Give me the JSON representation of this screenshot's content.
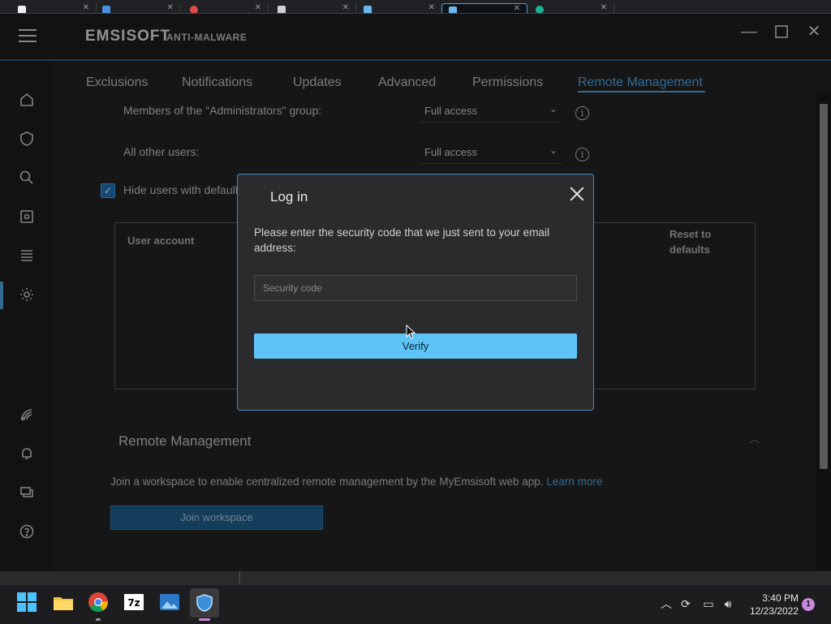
{
  "app": {
    "brand": "EMSISOFT",
    "product": "ANTI-MALWARE",
    "accent": "#4aa8e0"
  },
  "tabs": [
    {
      "label": "Exclusions"
    },
    {
      "label": "Notifications"
    },
    {
      "label": "Updates"
    },
    {
      "label": "Advanced"
    },
    {
      "label": "Permissions"
    },
    {
      "label": "Remote Management",
      "active": true
    }
  ],
  "permissions": {
    "admins_label": "Members of the \"Administrators\" group:",
    "admins_value": "Full access",
    "others_label": "All other users:",
    "others_value": "Full access",
    "hide_users_label": "Hide users with default",
    "user_account_header": "User account",
    "reset_header": "Reset to defaults"
  },
  "remote": {
    "section_title": "Remote Management",
    "description": "Join a workspace to enable centralized remote management by the MyEmsisoft web app.",
    "learn_more": "Learn more",
    "join_button": "Join workspace"
  },
  "modal": {
    "title": "Log in",
    "message": "Please enter the security code that we just sent to your email address:",
    "input_placeholder": "Security code",
    "input_value": "",
    "verify_button": "Verify"
  },
  "taskbar": {
    "time": "3:40 PM",
    "date": "12/23/2022",
    "notification_count": "1"
  }
}
